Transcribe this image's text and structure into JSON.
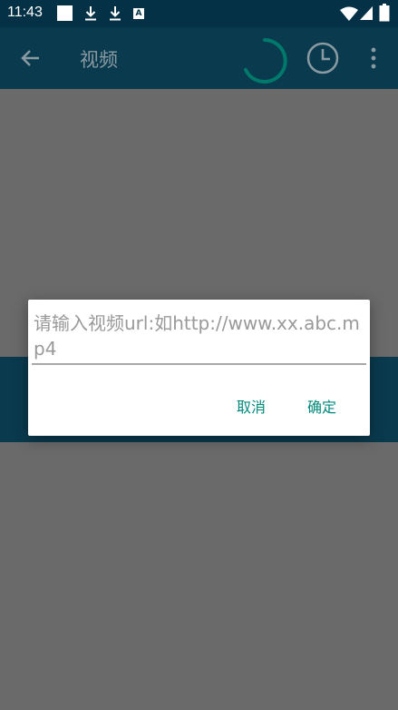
{
  "status_bar": {
    "time": "11:43",
    "battery_icon_label": "A",
    "colors": {
      "background": "#053146",
      "icons": "#ffffff"
    }
  },
  "toolbar": {
    "title": "视频",
    "icons": [
      "back-arrow-icon",
      "loading-spinner-icon",
      "history-clock-icon",
      "more-vert-icon"
    ],
    "colors": {
      "background": "#0a3a4e",
      "spinner": "#00796b"
    }
  },
  "dialog": {
    "input_placeholder": "请输入视频url:如http://www.xx.abc.mp4",
    "cancel_label": "取消",
    "confirm_label": "确定",
    "colors": {
      "button_text": "#00897b",
      "placeholder_text": "#999999"
    }
  },
  "scrim_color": "#6a6a6a"
}
